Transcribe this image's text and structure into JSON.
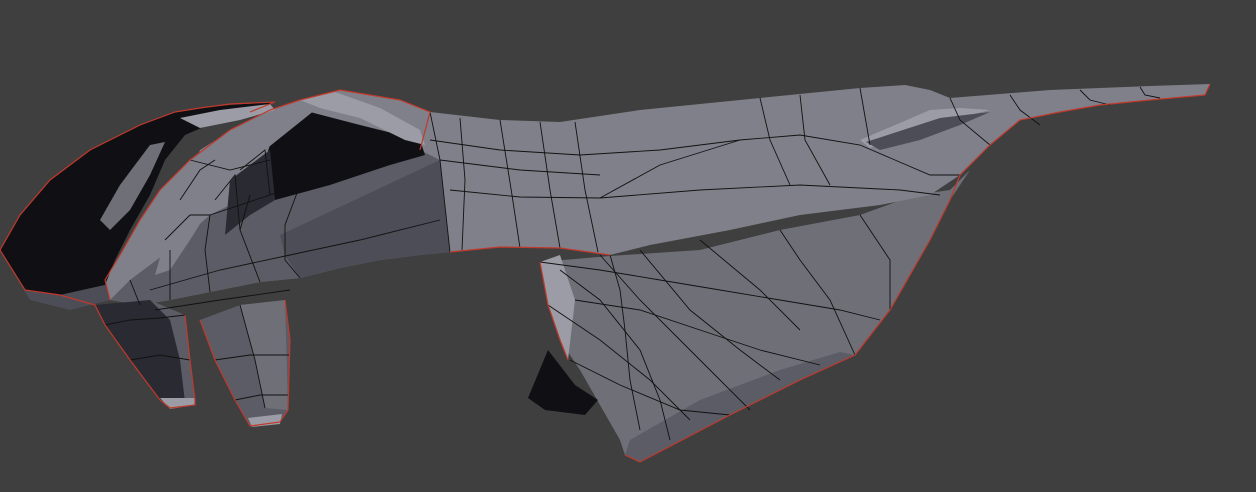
{
  "viewport": {
    "background": "#3f3f3f",
    "object": {
      "kind": "low-poly spaceship mesh",
      "shading": "solid grey",
      "outline_color": "#c0392b"
    }
  }
}
